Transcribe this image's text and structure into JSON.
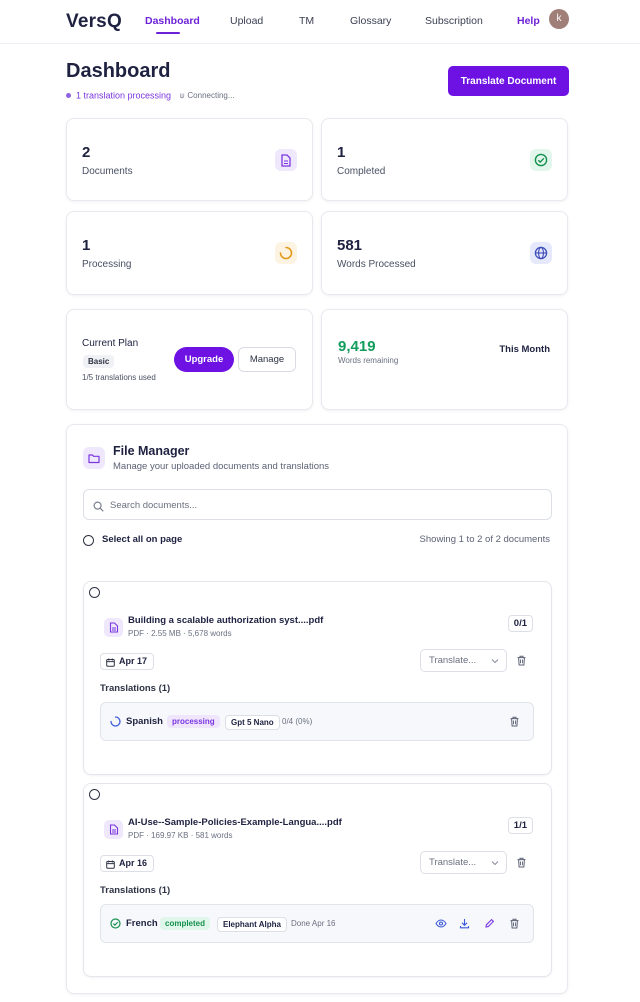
{
  "nav": {
    "brand": "VersQ",
    "links": [
      "Dashboard",
      "Upload",
      "TM",
      "Glossary",
      "Subscription",
      "Help"
    ],
    "avatar_letter": "k",
    "accent": "#6d12e3"
  },
  "header": {
    "title": "Dashboard",
    "processing_status": "1 translation processing",
    "connection_status": "Connecting...",
    "primary_button": "Translate Document"
  },
  "stats": [
    {
      "value": "2",
      "label": "Documents",
      "icon": "document-icon"
    },
    {
      "value": "1",
      "label": "Completed",
      "icon": "check-circle-icon"
    },
    {
      "value": "1",
      "label": "Processing",
      "icon": "spinner-icon"
    },
    {
      "value": "581",
      "label": "Words Processed",
      "icon": "globe-icon"
    }
  ],
  "plan": {
    "title": "Current Plan",
    "tier": "Basic",
    "usage": "1/5 translations used",
    "upgrade_label": "Upgrade",
    "manage_label": "Manage"
  },
  "words": {
    "remaining": "9,419",
    "remaining_label": "Words remaining",
    "period": "This Month"
  },
  "file_manager": {
    "title": "File Manager",
    "subtitle": "Manage your uploaded documents and translations",
    "search_placeholder": "Search documents...",
    "select_all_label": "Select all on page",
    "showing": "Showing 1 to 2 of 2 documents",
    "documents": [
      {
        "name": "Building a scalable authorization syst....pdf",
        "meta": "PDF · 2.55 MB · 5,678 words",
        "count": "0/1",
        "date": "Apr 17",
        "translate_placeholder": "Translate...",
        "translations_heading": "Translations (1)",
        "translations": [
          {
            "language": "Spanish",
            "status": "processing",
            "model": "Gpt 5 Nano",
            "info": "0/4 (0%)"
          }
        ]
      },
      {
        "name": "AI-Use--Sample-Policies-Example-Langua....pdf",
        "meta": "PDF · 169.97 KB · 581 words",
        "count": "1/1",
        "date": "Apr 16",
        "translate_placeholder": "Translate...",
        "translations_heading": "Translations (1)",
        "translations": [
          {
            "language": "French",
            "status": "completed",
            "model": "Elephant Alpha",
            "info": "Done Apr 16"
          }
        ]
      }
    ]
  }
}
